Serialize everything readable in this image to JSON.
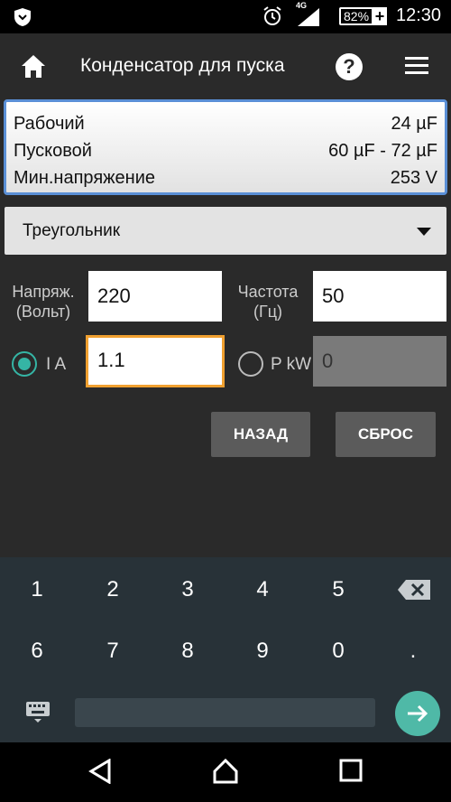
{
  "status_bar": {
    "network": "4G",
    "battery": "82%",
    "charge": "+",
    "time": "12:30"
  },
  "app_bar": {
    "title": "Конденсатор для пуска",
    "help": "?"
  },
  "results": [
    {
      "label": "Рабочий",
      "value": "24 µF"
    },
    {
      "label": "Пусковой",
      "value": "60 µF - 72 µF"
    },
    {
      "label": "Мин.напряжение",
      "value": "253 V"
    }
  ],
  "dropdown": {
    "selected": "Треугольник"
  },
  "voltage": {
    "label_line1": "Напряж.",
    "label_line2": "(Вольт)",
    "value": "220"
  },
  "frequency": {
    "label_line1": "Частота",
    "label_line2": "(Гц)",
    "value": "50"
  },
  "current": {
    "label": "I A",
    "value": "1.1",
    "checked": true
  },
  "power": {
    "label": "P kW",
    "value": "0",
    "checked": false
  },
  "buttons": {
    "back": "НАЗАД",
    "reset": "СБРОС"
  },
  "keyboard": {
    "row1": [
      "1",
      "2",
      "3",
      "4",
      "5"
    ],
    "row2": [
      "6",
      "7",
      "8",
      "9",
      "0",
      "."
    ]
  },
  "colors": {
    "accent": "#35b5a5",
    "active_border": "#f0a030",
    "result_border": "#5a8fd6"
  }
}
